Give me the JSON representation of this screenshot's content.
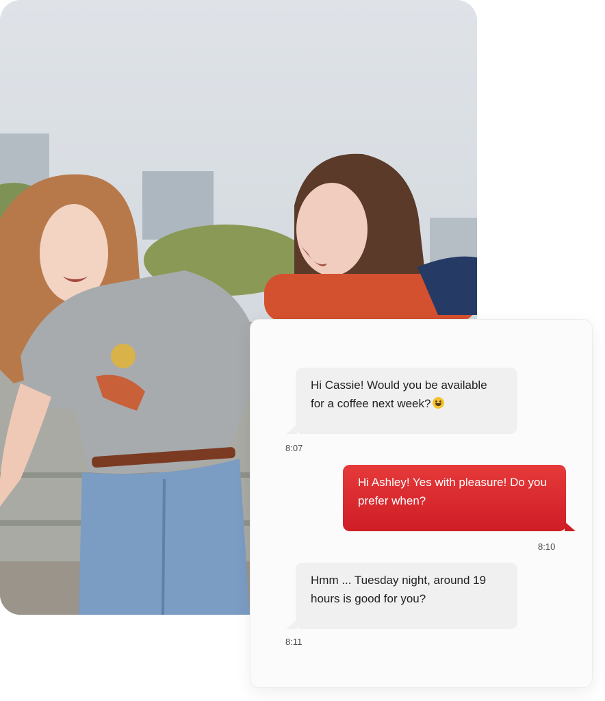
{
  "photo": {
    "alt": "Two young women laughing together outdoors"
  },
  "chat": {
    "messages": [
      {
        "direction": "incoming",
        "text": "Hi Cassie! Would you be available for a coffee next week?",
        "emoji": "grinning-face",
        "time": "8:07"
      },
      {
        "direction": "outgoing",
        "text": "Hi Ashley! Yes with pleasure! Do you prefer when?",
        "time": "8:10"
      },
      {
        "direction": "incoming",
        "text": "Hmm ... Tuesday night, around 19 hours is good for you?",
        "time": "8:11"
      }
    ]
  },
  "colors": {
    "outgoing_bubble": "#d9262d",
    "incoming_bubble": "#f0f0f0",
    "card_background": "#fbfbfb"
  }
}
